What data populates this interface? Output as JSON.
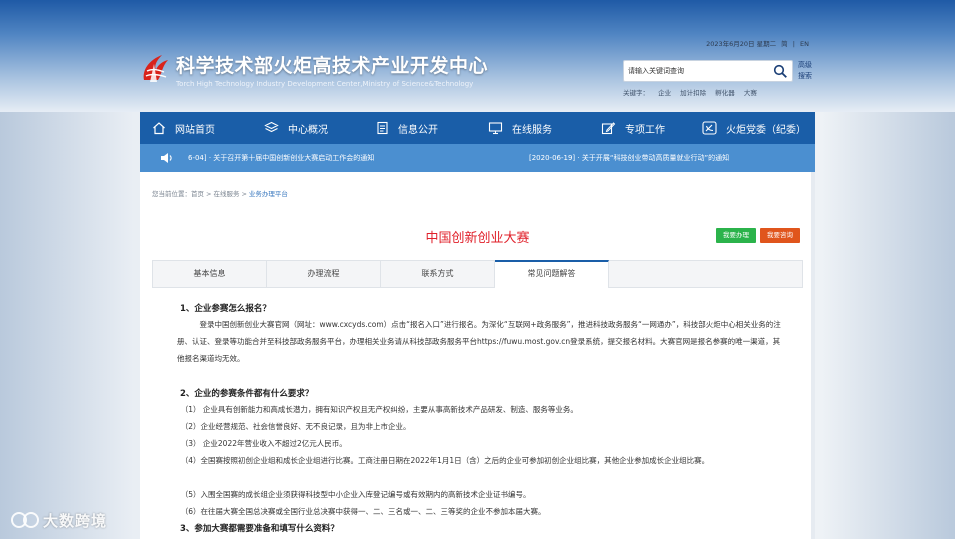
{
  "header": {
    "title": "科学技术部火炬高技术产业开发中心",
    "subtitle": "Torch High Technology Industry Development Center,Ministry of Science&Technology",
    "date": "2023年6月20日 星期二",
    "lang_simplified": "简",
    "lang_separator": "|",
    "lang_english": "EN",
    "search_placeholder": "请输入关键词查询",
    "advanced_search": "高级搜索",
    "keywords_label": "关键字：",
    "keywords": [
      "企业",
      "加计扣除",
      "孵化器",
      "大赛"
    ]
  },
  "nav": [
    "网站首页",
    "中心概况",
    "信息公开",
    "在线服务",
    "专项工作",
    "火炬党委（纪委）"
  ],
  "notices": [
    "6-04] · 关于召开第十届中国创新创业大赛启动工作会的通知",
    "[2020-06-19] · 关于开展“科技创业带动高质量就业行动”的通知"
  ],
  "breadcrumb": {
    "label": "您当前位置：",
    "items": [
      "首页",
      "在线服务",
      "业务办理平台"
    ],
    "separator": ">"
  },
  "page_title": "中国创新创业大赛",
  "buttons": {
    "handle": "我要办理",
    "consult": "我要咨询"
  },
  "tabs": [
    "基本信息",
    "办理流程",
    "联系方式",
    "常见问题解答"
  ],
  "active_tab": 3,
  "faq": {
    "q1": "1、企业参赛怎么报名？",
    "a1": "登录中国创新创业大赛官网（网址：www.cxcyds.com）点击“报名入口”进行报名。为深化“互联网+政务服务”，推进科技政务服务“一网通办”，科技部火炬中心相关业务的注册、认证、登录等功能合并至科技部政务服务平台，办理相关业务请从科技部政务服务平台https://fuwu.most.gov.cn登录系统，提交报名材料。大赛官网是报名参赛的唯一渠道，其他报名渠道均无效。",
    "q2": "2、企业的参赛条件都有什么要求？",
    "c1": "（1） 企业具有创新能力和高成长潜力，拥有知识产权且无产权纠纷，主要从事高新技术产品研发、制造、服务等业务。",
    "c2": "（2）企业经营规范、社会信誉良好、无不良记录，且为非上市企业。",
    "c3": "（3） 企业2022年营业收入不超过2亿元人民币。",
    "c4": "（4）全国赛按照初创企业组和成长企业组进行比赛。工商注册日期在2022年1月1日（含）之后的企业可参加初创企业组比赛，其他企业参加成长企业组比赛。",
    "c5": "（5）入围全国赛的成长组企业须获得科技型中小企业入库登记编号或有效期内的高新技术企业证书编号。",
    "c6": "（6）在往届大赛全国总决赛或全国行业总决赛中获得一、二、三名或一、二、三等奖的企业不参加本届大赛。",
    "q3": "3、参加大赛都需要准备和填写什么资料？"
  },
  "watermark": "大数跨境",
  "colors": {
    "nav_bg": "#1a5ea8",
    "notice_bg": "#4b8fd0",
    "title_red": "#e0202a",
    "handle_green": "#2bb34b",
    "consult_orange": "#e0551c"
  }
}
